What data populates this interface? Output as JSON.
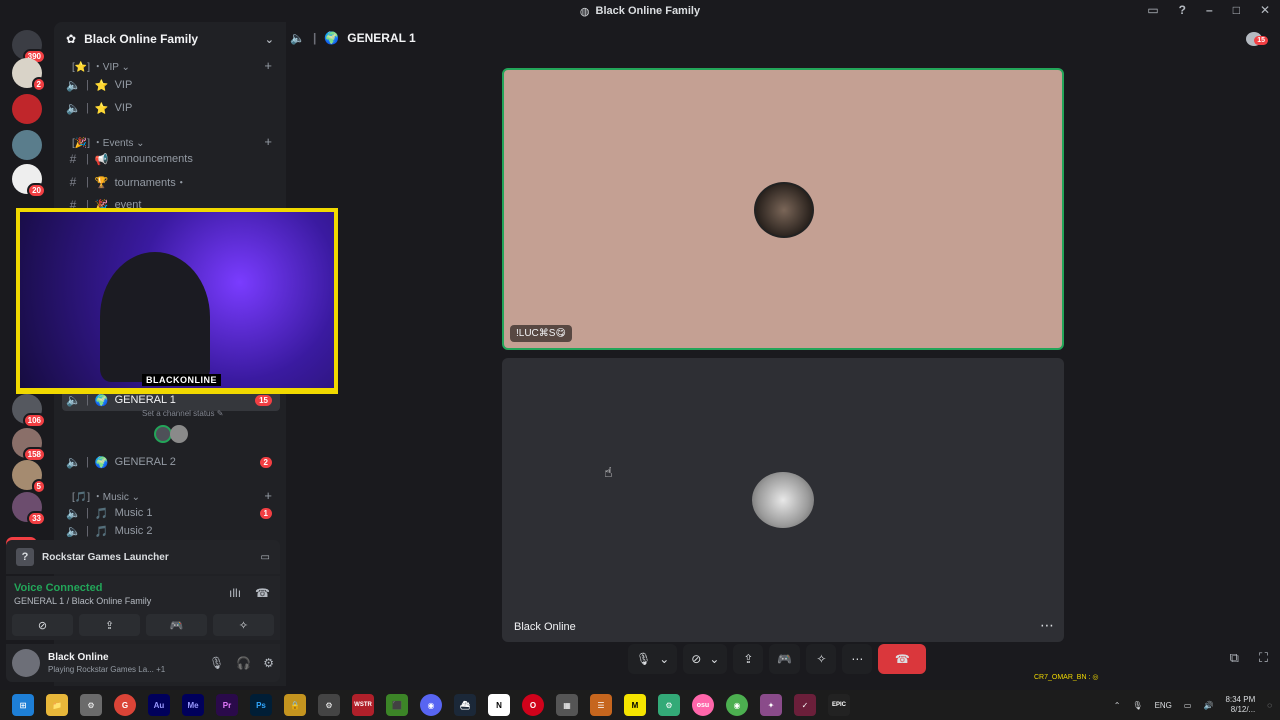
{
  "window": {
    "title": "Black Online Family"
  },
  "servers": {
    "badges": [
      "390",
      "2",
      "",
      "",
      "20",
      "",
      "",
      "",
      "",
      "",
      "",
      "106",
      "158",
      "5",
      "33"
    ],
    "new_label": "NEW"
  },
  "guild": {
    "name": "Black Online Family"
  },
  "categories": [
    {
      "label": "[⭐] ・VIP ⌄"
    },
    {
      "label": "[🎉] ・Events ⌄"
    },
    {
      "label": "[🎵] ・Music ⌄"
    }
  ],
  "channels": [
    {
      "name": "VIP",
      "emoji": "⭐"
    },
    {
      "name": "VIP",
      "emoji": "⭐"
    },
    {
      "name": "announcements",
      "emoji": "📢"
    },
    {
      "name": "tournaments・",
      "emoji": "🏆"
    },
    {
      "name": "event",
      "emoji": "🎉"
    },
    {
      "name": "GENERAL 1",
      "emoji": "🌍",
      "count": "15",
      "status": "Set a channel status ✎"
    },
    {
      "name": "GENERAL 2",
      "emoji": "🌍",
      "count": "2"
    },
    {
      "name": "Music 1",
      "emoji": "🎵",
      "count": "1"
    },
    {
      "name": "Music 2",
      "emoji": "🎵"
    }
  ],
  "webcam": {
    "label": "BLACKONLINE"
  },
  "activity": {
    "game": "Rockstar Games Launcher"
  },
  "voice": {
    "title": "Voice Connected",
    "channel": "GENERAL 1 / Black Online Family"
  },
  "user": {
    "name": "Black Online",
    "activity": "Playing Rockstar Games La...",
    "extra": "+1"
  },
  "stage": {
    "channel": "GENERAL 1",
    "inbox_count": "15",
    "tile1_name": "!LUC⌘S😋",
    "tile2_name": "Black Online"
  },
  "overlay": {
    "watermark": "CR7_OMAR_BN : ◎"
  },
  "taskbar": {
    "apps": [
      "⊞",
      "📁",
      "⚙",
      "G",
      "Au",
      "Me",
      "Pr",
      "Ps",
      "🔒",
      "⚙",
      "WSTR",
      "⬛",
      "◉",
      "⛴",
      "N",
      "O",
      "▦",
      "☰",
      "M",
      "⚙",
      "osu",
      "◉",
      "✦",
      "✓",
      "EPIC"
    ],
    "lang": "ENG",
    "time": "8:34 PM",
    "date": "8/12/..."
  },
  "colors": {
    "accent_green": "#23a559",
    "danger": "#da373c",
    "cam_border": "#f1d900"
  }
}
